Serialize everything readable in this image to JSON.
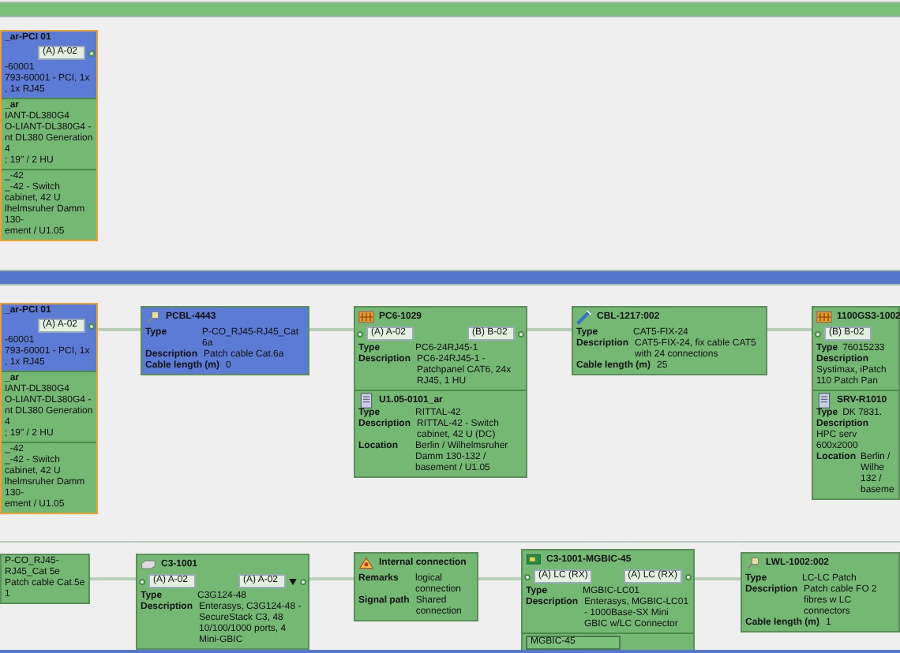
{
  "bands": [
    {
      "kind": "bar",
      "color": "#78bf78",
      "nodes": [
        {
          "selected": true,
          "color": "#5b7bd5",
          "title": "_ar-PCI 01",
          "ports": [
            {
              "kind": "right",
              "label": "(A) A-02"
            }
          ],
          "sections": [
            {
              "kind": "lines",
              "color": "#5b7bd5",
              "lines": [
                "-60001",
                "793-60001 - PCI, 1x",
                ", 1x RJ45"
              ]
            },
            {
              "kind": "lines",
              "color": "#74b874",
              "title": "_ar",
              "lines": [
                "IANT-DL380G4",
                "O-LIANT-DL380G4 -",
                "nt DL380 Generation 4",
                "; 19\" / 2 HU"
              ]
            },
            {
              "kind": "lines",
              "color": "#74b874",
              "lines": [
                "_-42",
                "_-42 - Switch cabinet, 42 U",
                "lhelmsruher Damm 130-",
                "ement / U1.05"
              ]
            }
          ]
        }
      ]
    },
    {
      "kind": "bar",
      "color": "#5577cc",
      "nodes": [
        {
          "selected": true,
          "color": "#5b7bd5",
          "title": "_ar-PCI 01",
          "ports": [
            {
              "kind": "right",
              "label": "(A) A-02"
            }
          ],
          "sections": [
            {
              "kind": "lines",
              "color": "#5b7bd5",
              "lines": [
                "-60001",
                "793-60001 - PCI, 1x",
                ", 1x RJ45"
              ]
            },
            {
              "kind": "lines",
              "color": "#74b874",
              "title": "_ar",
              "lines": [
                "IANT-DL380G4",
                "O-LIANT-DL380G4 -",
                "nt DL380 Generation 4",
                "; 19\" / 2 HU"
              ]
            },
            {
              "kind": "lines",
              "color": "#74b874",
              "lines": [
                "_-42",
                "_-42 - Switch cabinet, 42 U",
                "lhelmsruher Damm 130-",
                "ement / U1.05"
              ]
            }
          ]
        },
        {
          "kind": "patch-cable",
          "selected": false,
          "color": "#5b7bd5",
          "title": "PCBL-4443",
          "sections": [
            {
              "kind": "rows",
              "color": "#5b7bd5",
              "rows": [
                {
                  "label": "Type",
                  "value": "P-CO_RJ45-RJ45_Cat 6a"
                },
                {
                  "label": "Description",
                  "value": "Patch cable Cat.6a"
                },
                {
                  "label": "Cable length (m)",
                  "value": "0"
                }
              ]
            }
          ]
        },
        {
          "kind": "patch-panel",
          "selected": false,
          "color": "#74b874",
          "title": "PC6-1029",
          "ports": [
            {
              "kind": "left",
              "label": "(A) A-02"
            },
            {
              "kind": "right",
              "label": "(B) B-02"
            }
          ],
          "sections": [
            {
              "kind": "rows",
              "color": "#74b874",
              "rows": [
                {
                  "label": "Type",
                  "value": "PC6-24RJ45-1"
                },
                {
                  "label": "Description",
                  "value": "PC6-24RJ45-1 - Patchpanel CAT6, 24x RJ45, 1 HU"
                }
              ]
            },
            {
              "kind": "location",
              "color": "#74b874",
              "title": "U1.05-0101_ar",
              "rows": [
                {
                  "label": "Type",
                  "value": "RITTAL-42"
                },
                {
                  "label": "Description",
                  "value": "RITTAL-42 - Switch cabinet, 42 U (DC)"
                },
                {
                  "label": "Location",
                  "value": "Berlin / Wilhelmsruher Damm 130-132 / basement / U1.05"
                }
              ]
            }
          ]
        },
        {
          "kind": "cable",
          "selected": false,
          "color": "#74b874",
          "title": "CBL-1217:002",
          "sections": [
            {
              "kind": "rows",
              "color": "#74b874",
              "rows": [
                {
                  "label": "Type",
                  "value": "CAT5-FIX-24"
                },
                {
                  "label": "Description",
                  "value": "CAT5-FIX-24, fix cable CAT5 with 24 connections"
                },
                {
                  "label": "Cable length (m)",
                  "value": "25"
                }
              ]
            }
          ]
        },
        {
          "kind": "patch-panel",
          "selected": false,
          "color": "#74b874",
          "title": "1100GS3-1002",
          "ports": [
            {
              "kind": "left",
              "label": "(B) B-02"
            }
          ],
          "sections": [
            {
              "kind": "rows",
              "color": "#74b874",
              "rows": [
                {
                  "label": "Type",
                  "value": "76015233"
                },
                {
                  "label": "Description",
                  "value": "Systimax, iPatch 110 Patch Pan"
                }
              ]
            },
            {
              "kind": "location",
              "color": "#74b874",
              "title": "SRV-R1010",
              "rows": [
                {
                  "label": "Type",
                  "value": "DK 7831."
                },
                {
                  "label": "Description",
                  "value": "HPC serv 600x2000"
                },
                {
                  "label": "Location",
                  "value": "Berlin / Wilhe 132 / baseme"
                }
              ]
            }
          ]
        }
      ]
    },
    {
      "kind": "line",
      "color": "#b9c9b9",
      "nodes": [
        {
          "selected": false,
          "color": "#74b874",
          "sections": [
            {
              "kind": "lines",
              "color": "#74b874",
              "lines": [
                "P-CO_RJ45-RJ45_Cat 5e",
                "Patch cable Cat.5e",
                "1"
              ]
            }
          ]
        },
        {
          "kind": "switch",
          "selected": false,
          "color": "#74b874",
          "title": "C3-1001",
          "ports": [
            {
              "kind": "left",
              "label": "(A) A-02"
            },
            {
              "kind": "right",
              "label": "(A) A-02",
              "dropdown": true
            }
          ],
          "sections": [
            {
              "kind": "rows",
              "color": "#74b874",
              "rows": [
                {
                  "label": "Type",
                  "value": "C3G124-48"
                },
                {
                  "label": "Description",
                  "value": "Enterasys, C3G124-48 - SecureStack C3, 48 10/100/1000 ports, 4 Mini-GBIC"
                }
              ]
            }
          ]
        },
        {
          "kind": "connection",
          "selected": false,
          "color": "#74b874",
          "title": "Internal connection",
          "sections": [
            {
              "kind": "rows",
              "color": "#74b874",
              "rows": [
                {
                  "label": "Remarks",
                  "value": "logical connection"
                },
                {
                  "label": "Signal path",
                  "value": "Shared connection"
                }
              ]
            }
          ]
        },
        {
          "kind": "module",
          "selected": false,
          "color": "#74b874",
          "title": "C3-1001-MGBIC-45",
          "ports": [
            {
              "kind": "left",
              "label": "(A) LC (RX)"
            },
            {
              "kind": "right",
              "label": "(A) LC (RX)"
            }
          ],
          "sections": [
            {
              "kind": "rows",
              "color": "#74b874",
              "rows": [
                {
                  "label": "Type",
                  "value": "MGBIC-LC01"
                },
                {
                  "label": "Description",
                  "value": "Enterasys, MGBIC-LC01 - 1000Base-SX Mini GBIC w/LC Connector"
                }
              ]
            },
            {
              "kind": "box",
              "color": "#74b874",
              "lines": [
                "MGBIC-45"
              ]
            }
          ]
        },
        {
          "kind": "patch-cable",
          "selected": false,
          "color": "#74b874",
          "title": "LWL-1002:002",
          "sections": [
            {
              "kind": "rows",
              "color": "#74b874",
              "rows": [
                {
                  "label": "Type",
                  "value": "LC-LC Patch"
                },
                {
                  "label": "Description",
                  "value": "Patch cable FO 2 fibres w LC connectors"
                },
                {
                  "label": "Cable length (m)",
                  "value": "1"
                }
              ]
            }
          ]
        }
      ]
    },
    {
      "kind": "bar",
      "color": "#5577cc"
    }
  ]
}
